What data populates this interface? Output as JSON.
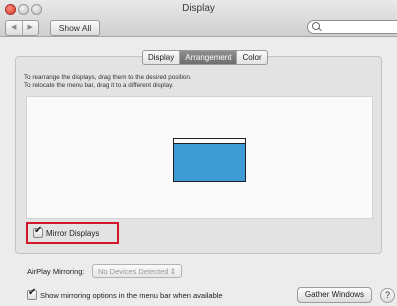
{
  "window": {
    "title": "Display"
  },
  "toolbar": {
    "back_icon": "◀",
    "forward_icon": "▶",
    "show_all_label": "Show All",
    "search_value": "",
    "search_placeholder": ""
  },
  "tabs": [
    {
      "label": "Display",
      "active": false
    },
    {
      "label": "Arrangement",
      "active": true
    },
    {
      "label": "Color",
      "active": false
    }
  ],
  "arrangement": {
    "instruction_line1": "To rearrange the displays, drag them to the desired position.",
    "instruction_line2": "To relocate the menu bar, drag it to a different display."
  },
  "mirror": {
    "label": "Mirror Displays",
    "checked": true,
    "highlight_color": "#d0182a"
  },
  "airplay": {
    "label": "AirPlay Mirroring:",
    "selected": "No Devices Detected",
    "dropdown_arrow": "⇕"
  },
  "show_mirroring": {
    "label": "Show mirroring options in the menu bar when available",
    "checked": true
  },
  "buttons": {
    "gather_windows": "Gather Windows",
    "help": "?"
  },
  "colors": {
    "display_fill": "#3f9bd4",
    "active_tab": "#7a7a7a"
  }
}
